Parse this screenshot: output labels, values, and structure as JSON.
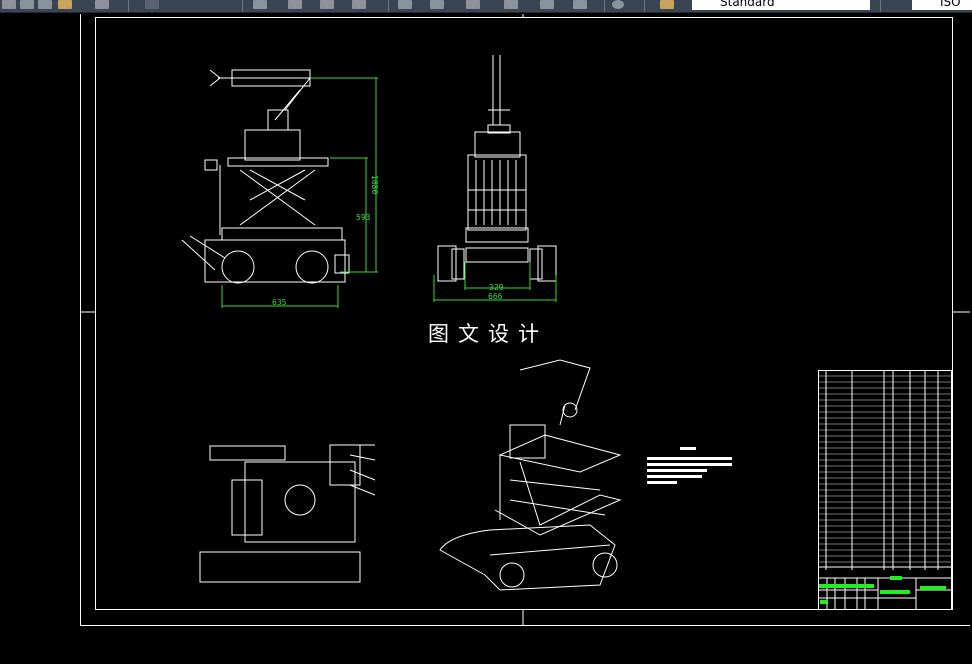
{
  "toolbar": {
    "text_style": "Standard",
    "dim_style": "ISO",
    "icons": [
      "open-icon",
      "save-icon",
      "match-properties-icon",
      "print-icon",
      "undo-icon",
      "redo-icon",
      "pan-icon",
      "zoom-realtime-icon",
      "zoom-window-icon",
      "zoom-previous-icon",
      "properties-icon",
      "design-center-icon",
      "tool-palette-icon",
      "sheet-set-icon",
      "markup-icon",
      "calculator-icon",
      "help-icon",
      "text-style-icon"
    ]
  },
  "drawing": {
    "title": "图文设计",
    "dimensions": {
      "side_height_total": "1080",
      "side_height_lower": "593",
      "side_width": "635",
      "front_inner_width": "329",
      "front_overall_width": "666"
    },
    "colors": {
      "background": "#000000",
      "lines": "#ffffff",
      "dimensions": "#33dd33",
      "title_block_fill": "#22ee22"
    }
  }
}
